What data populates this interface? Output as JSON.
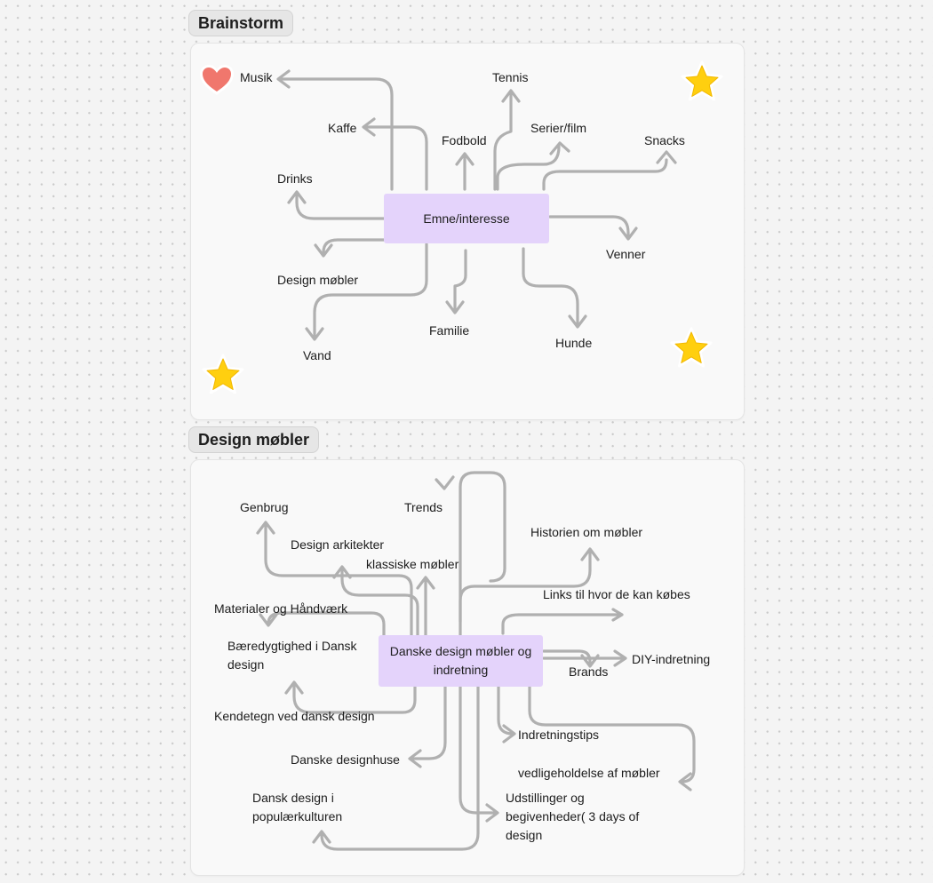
{
  "brainstorm": {
    "title": "Brainstorm",
    "center": "Emne/interesse",
    "topics": {
      "musik": "Musik",
      "kaffe": "Kaffe",
      "drinks": "Drinks",
      "fodbold": "Fodbold",
      "tennis": "Tennis",
      "serier": "Serier/film",
      "snacks": "Snacks",
      "venner": "Venner",
      "design": "Design møbler",
      "familie": "Familie",
      "hunde": "Hunde",
      "vand": "Vand"
    }
  },
  "design": {
    "title": "Design møbler",
    "center": "Danske design møbler og indretning",
    "topics": {
      "genbrug": "Genbrug",
      "trends": "Trends",
      "arkitekter": "Design arkitekter",
      "klassiske": "klassiske  møbler",
      "historien": "Historien om møbler",
      "materialer": "Materialer og Håndværk",
      "links": "Links til hvor de kan købes",
      "baeredygtighed": "Bæredygtighed i Dansk design",
      "brands": "Brands",
      "diy": "DIY-indretning",
      "kendetegn": "Kendetegn ved dansk design",
      "indretningstips": "Indretningstips",
      "designhuse": "Danske designhuse",
      "vedligehold": "vedligeholdelse af møbler",
      "popkultur": "Dansk design i populærkulturen",
      "udstillinger": "Udstillinger og begivenheder( 3 days of design"
    }
  },
  "colors": {
    "node": "#e4d3fb",
    "connector": "#b0b0b0",
    "star": "#ffcf0f",
    "heart": "#f0776d"
  },
  "icons": [
    "heart-icon",
    "star-icon"
  ]
}
